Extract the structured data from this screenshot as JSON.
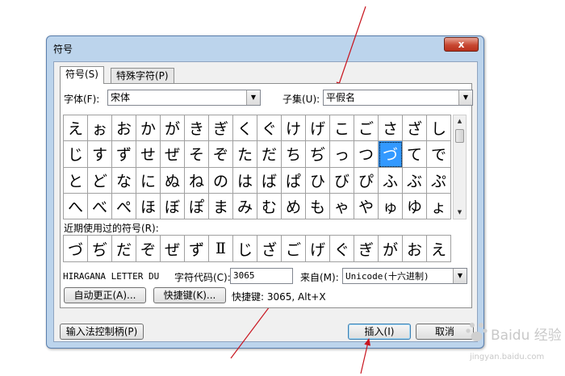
{
  "window": {
    "title": "符号",
    "close_label": "x"
  },
  "tabs": [
    {
      "label": "符号(S)",
      "active": true
    },
    {
      "label": "特殊字符(P)",
      "active": false
    }
  ],
  "font": {
    "label": "字体(F):",
    "value": "宋体"
  },
  "subset": {
    "label": "子集(U):",
    "value": "平假名"
  },
  "symbols": [
    [
      "え",
      "ぉ",
      "お",
      "か",
      "が",
      "き",
      "ぎ",
      "く",
      "ぐ",
      "け",
      "げ",
      "こ",
      "ご",
      "さ",
      "ざ",
      "し"
    ],
    [
      "じ",
      "す",
      "ず",
      "せ",
      "ぜ",
      "そ",
      "ぞ",
      "た",
      "だ",
      "ち",
      "ぢ",
      "っ",
      "つ",
      "づ",
      "て",
      "で"
    ],
    [
      "と",
      "ど",
      "な",
      "に",
      "ぬ",
      "ね",
      "の",
      "は",
      "ば",
      "ぱ",
      "ひ",
      "び",
      "ぴ",
      "ふ",
      "ぶ",
      "ぷ"
    ],
    [
      "へ",
      "べ",
      "ぺ",
      "ほ",
      "ぼ",
      "ぽ",
      "ま",
      "み",
      "む",
      "め",
      "も",
      "ゃ",
      "や",
      "ゅ",
      "ゆ",
      "ょ"
    ]
  ],
  "selected_symbol": "づ",
  "recent": {
    "label": "近期使用过的符号(R):",
    "items": [
      "づ",
      "ぢ",
      "だ",
      "ぞ",
      "ぜ",
      "ず",
      "Ⅱ",
      "じ",
      "ざ",
      "ご",
      "げ",
      "ぐ",
      "ぎ",
      "が",
      "お",
      "え"
    ]
  },
  "char_name": "HIRAGANA LETTER DU",
  "char_code": {
    "label": "字符代码(C):",
    "value": "3065"
  },
  "from": {
    "label": "来自(M):",
    "value": "Unicode(十六进制)"
  },
  "autocorrect_label": "自动更正(A)...",
  "shortcut_key_label": "快捷键(K)...",
  "shortcut_text": "快捷键: 3065, Alt+X",
  "ime_button_label": "输入法控制柄(P)",
  "insert_label": "插入(I)",
  "cancel_label": "取消",
  "watermark": {
    "brand": "Baidu 经验",
    "url": "jingyan.baidu.com"
  },
  "colors": {
    "selection": "#3399ff",
    "annotation_arrow": "#c8141e",
    "window_frame": "#bcd4ec"
  }
}
